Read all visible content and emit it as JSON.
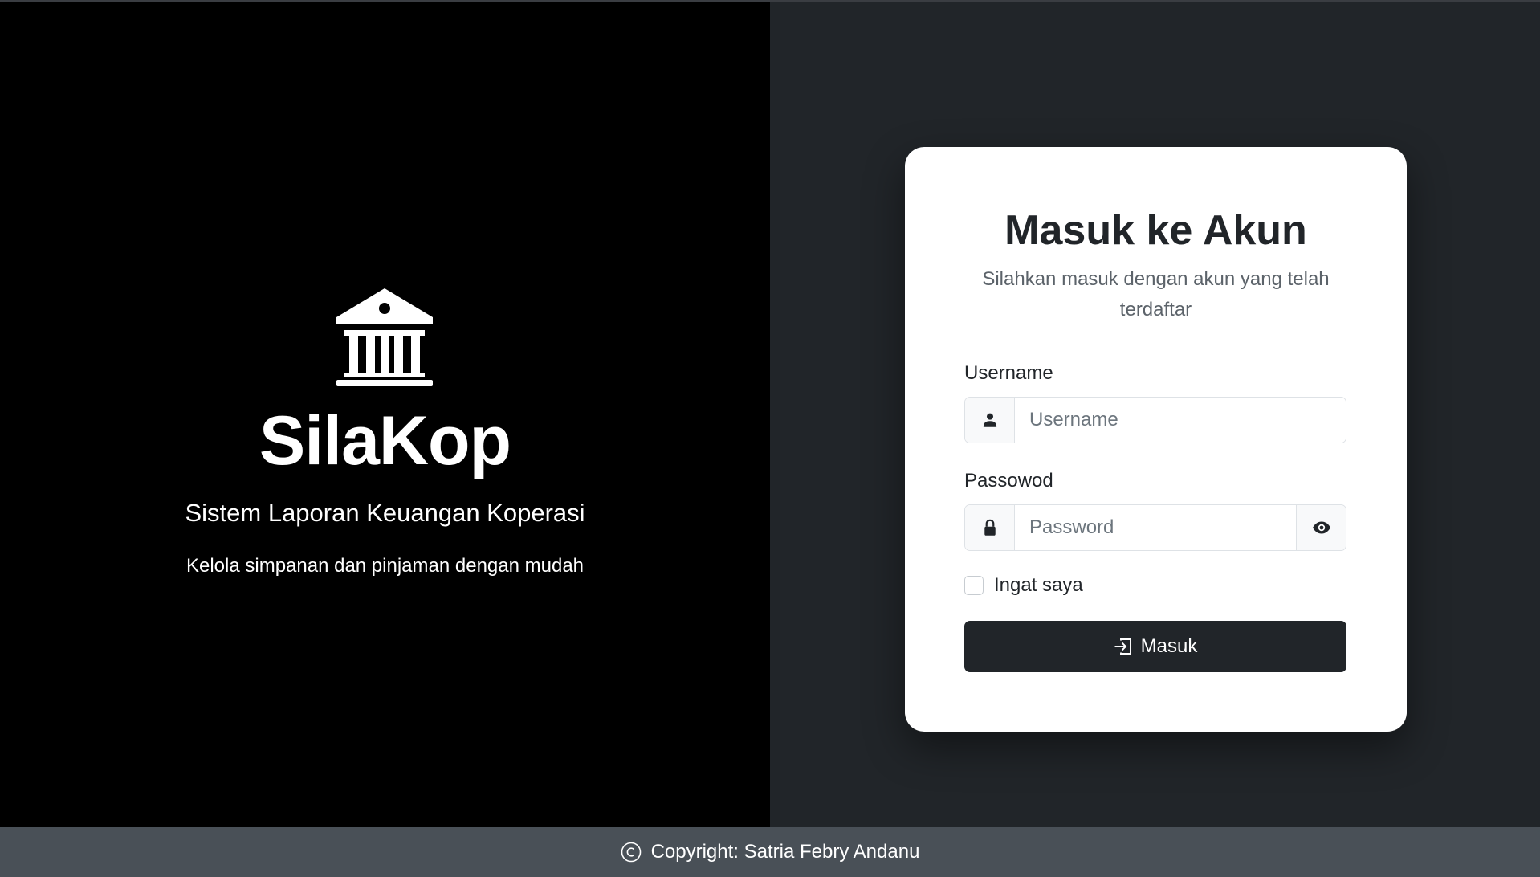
{
  "brand": {
    "icon": "bank-icon",
    "title": "SilaKop",
    "subtitle": "Sistem Laporan Keuangan Koperasi",
    "tagline": "Kelola simpanan dan pinjaman dengan mudah"
  },
  "login": {
    "title": "Masuk ke Akun",
    "subtitle": "Silahkan masuk dengan akun yang telah terdaftar",
    "username": {
      "label": "Username",
      "placeholder": "Username",
      "value": "",
      "icon": "person-icon"
    },
    "password": {
      "label": "Passowod",
      "placeholder": "Password",
      "value": "",
      "icon": "lock-icon",
      "toggle_icon": "eye-icon"
    },
    "remember": {
      "label": "Ingat saya",
      "checked": false
    },
    "submit": {
      "label": "Masuk",
      "icon": "box-arrow-in-right-icon"
    }
  },
  "footer": {
    "icon": "copyright-icon",
    "text": "Copyright: Satria Febry Andanu"
  },
  "colors": {
    "left_bg": "#000000",
    "right_bg": "#212529",
    "card_bg": "#ffffff",
    "button_bg": "#212529",
    "footer_bg": "#495057"
  }
}
